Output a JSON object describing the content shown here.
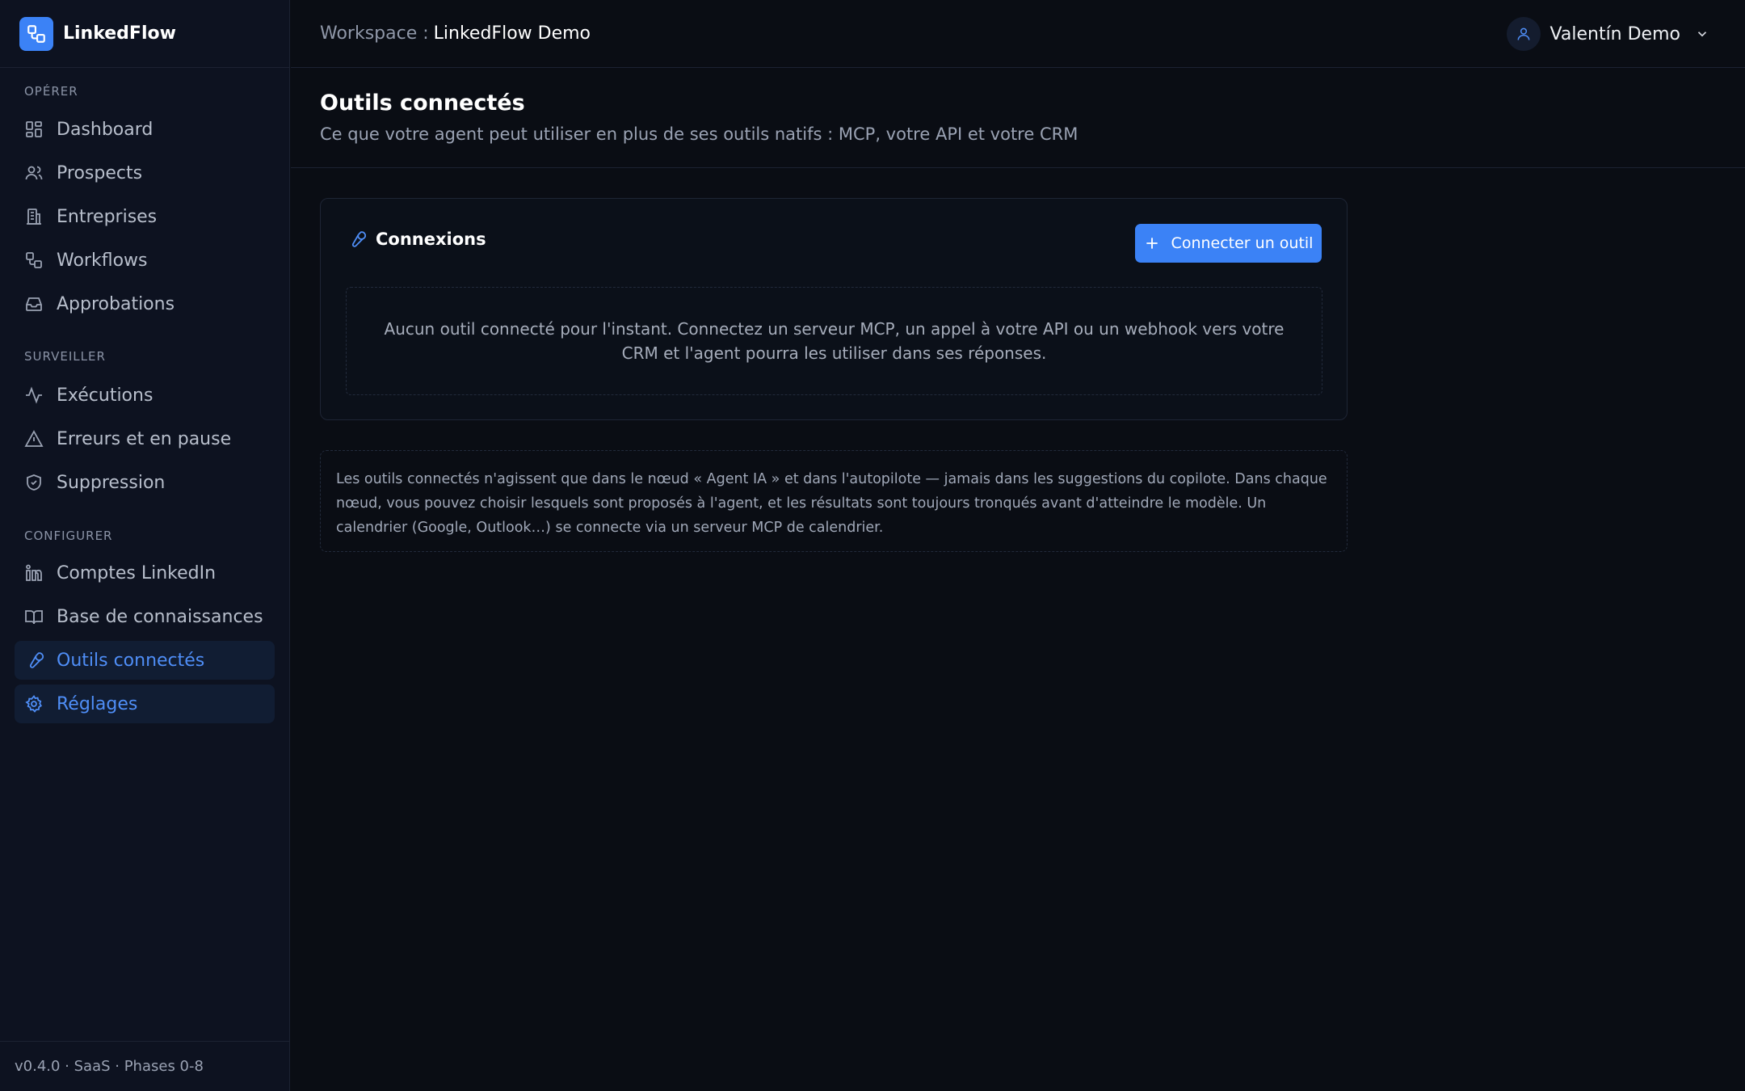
{
  "brand": {
    "name": "LinkedFlow"
  },
  "sidebar": {
    "sections": [
      {
        "title": "OPÉRER"
      },
      {
        "title": "SURVEILLER"
      },
      {
        "title": "CONFIGURER"
      }
    ],
    "items": [
      {
        "label": "Dashboard",
        "icon": "dashboard-icon"
      },
      {
        "label": "Prospects",
        "icon": "users-icon"
      },
      {
        "label": "Entreprises",
        "icon": "building-icon"
      },
      {
        "label": "Workflows",
        "icon": "workflow-icon"
      },
      {
        "label": "Approbations",
        "icon": "inbox-icon"
      },
      {
        "label": "Exécutions",
        "icon": "activity-icon"
      },
      {
        "label": "Erreurs et en pause",
        "icon": "warning-icon"
      },
      {
        "label": "Suppression",
        "icon": "shield-icon"
      },
      {
        "label": "Comptes LinkedIn",
        "icon": "linkedin-icon"
      },
      {
        "label": "Base de connaissances",
        "icon": "book-icon"
      },
      {
        "label": "Outils connectés",
        "icon": "wrench-icon",
        "active": true
      },
      {
        "label": "Réglages",
        "icon": "gear-icon",
        "active": true
      }
    ],
    "footer": "v0.4.0 · SaaS · Phases 0-8"
  },
  "header": {
    "workspace_label": "Workspace :",
    "workspace_name": "LinkedFlow Demo",
    "user_name": "Valentín Demo"
  },
  "page": {
    "title": "Outils connectés",
    "subtitle": "Ce que votre agent peut utiliser en plus de ses outils natifs : MCP, votre API et votre CRM"
  },
  "connections": {
    "title": "Connexions",
    "connect_button": "Connecter un outil",
    "empty_message": "Aucun outil connecté pour l'instant. Connectez un serveur MCP, un appel à votre API ou un webhook vers votre CRM et l'agent pourra les utiliser dans ses réponses."
  },
  "note": "Les outils connectés n'agissent que dans le nœud « Agent IA » et dans l'autopilote — jamais dans les suggestions du copilote. Dans chaque nœud, vous pouvez choisir lesquels sont proposés à l'agent, et les résultats sont toujours tronqués avant d'atteindre le modèle. Un calendrier (Google, Outlook…) se connecte via un serveur MCP de calendrier.",
  "colors": {
    "accent": "#3b82f6",
    "background": "#0a0d14",
    "sidebar": "#0d1220"
  }
}
